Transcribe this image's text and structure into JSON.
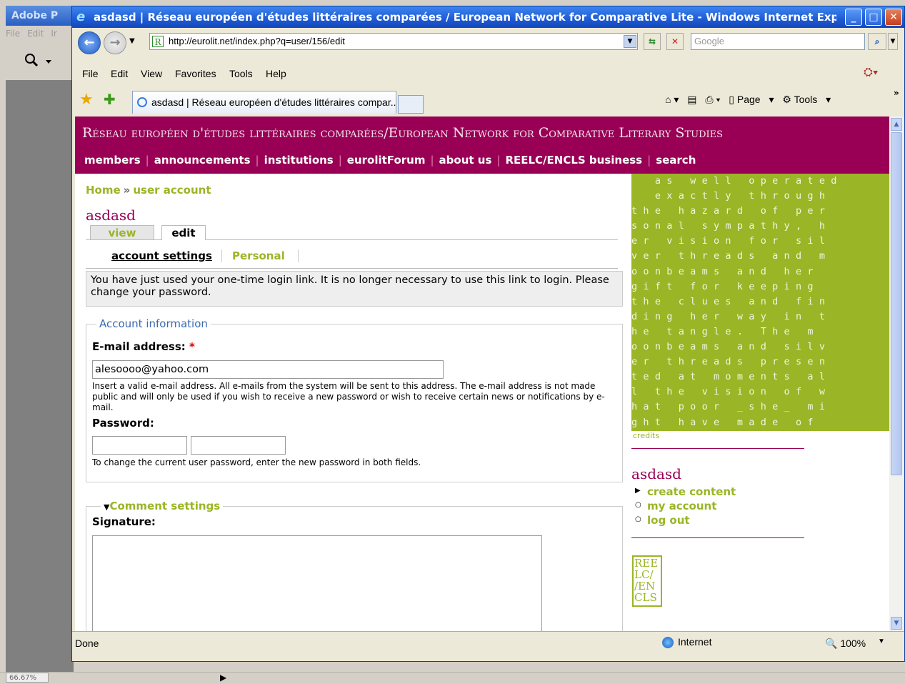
{
  "adobe": {
    "title": "Adobe P",
    "menu": [
      "File",
      "Edit",
      "Ir"
    ],
    "zoom": "66.67%"
  },
  "ie": {
    "title": "asdasd | Réseau européen d'études littéraires comparées / European Network for Comparative Lite - Windows Internet Explorer",
    "url": "http://eurolit.net/index.php?q=user/156/edit",
    "search_placeholder": "Google",
    "menu": [
      "File",
      "Edit",
      "View",
      "Favorites",
      "Tools",
      "Help"
    ],
    "tab_label": "asdasd | Réseau européen d'études littéraires compar...",
    "command_bar": [
      "Page",
      "Tools"
    ],
    "status": "Done",
    "zone": "Internet",
    "zoom": "100%"
  },
  "site": {
    "name": "Réseau européen d'études littéraires comparées/European Network for Comparative Literary Studies",
    "nav": [
      "members",
      "announcements",
      "institutions",
      "eurolitForum",
      "about us",
      "REELC/ENCLS business",
      "search"
    ]
  },
  "page": {
    "breadcrumb": [
      "Home",
      "user account"
    ],
    "breadcrumb_sep": "»",
    "title": "asdasd",
    "tabs": [
      "view",
      "edit"
    ],
    "subtabs": [
      "account settings",
      "Personal"
    ],
    "message": "You have just used your one-time login link. It is no longer necessary to use this link to login. Please change your password.",
    "account_legend": "Account information",
    "email_label": "E-mail address:",
    "required_mark": "*",
    "email_value": "alesoooo@yahoo.com",
    "email_desc": "Insert a valid e-mail address. All e-mails from the system will be sent to this address. The e-mail address is not made public and will only be used if you wish to receive a new password or wish to receive certain news or notifications by e-mail.",
    "password_label": "Password:",
    "password_desc": "To change the current user password, enter the new password in both fields.",
    "comment_legend": "Comment settings",
    "signature_label": "Signature:"
  },
  "sidebar": {
    "art_text": "  as well operated\n  exactly through\nthe hazard of per\nsonal sympathy, h\ner vision for sil\nver threads and m\noonbeams and her\ngift for keeping\nthe clues and fin\nding her way in t\nhe tangle. The m\noonbeams and silv\ner threads presen\nted at moments al\nl the vision of w\nhat poor _she_ mi\nght have made of",
    "credits": "credits",
    "user_title": "asdasd",
    "links": [
      "create content",
      "my account",
      "log out"
    ],
    "logo_text": "REE LC/ /EN CLS"
  },
  "colors": {
    "brand": "#990055",
    "accent": "#9ab526"
  }
}
